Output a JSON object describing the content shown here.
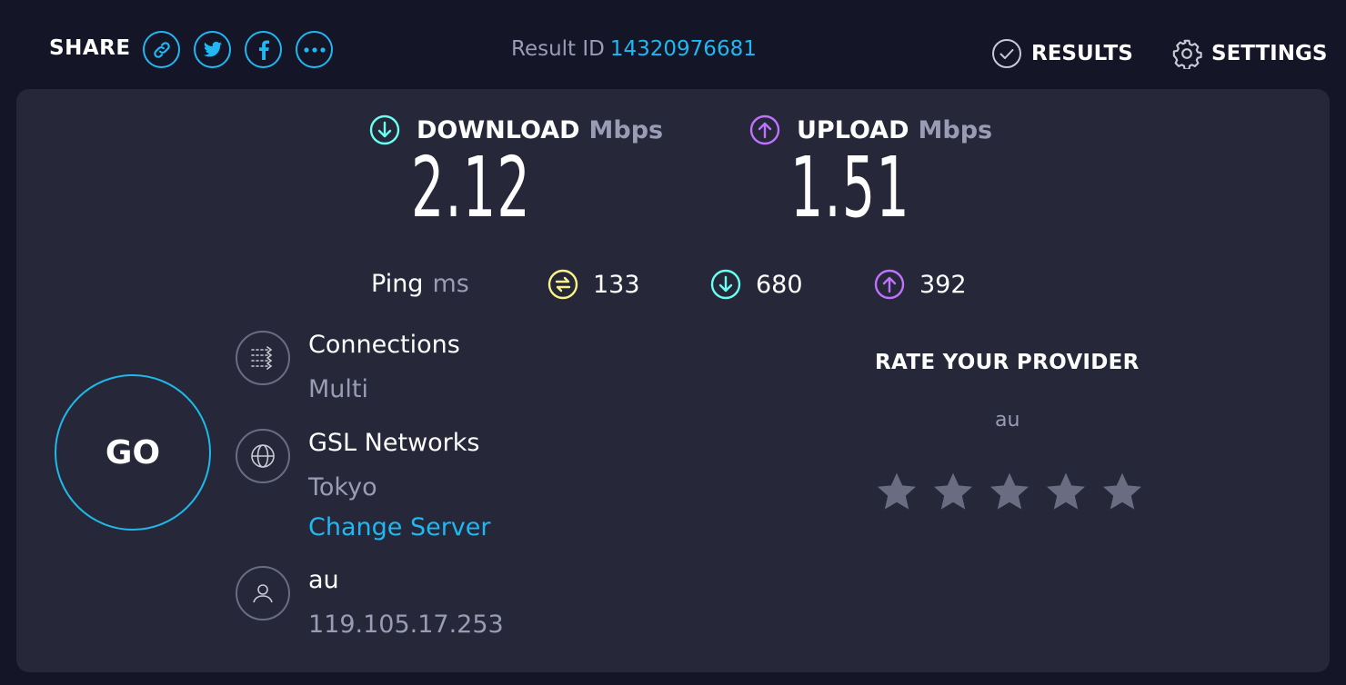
{
  "header": {
    "share_label": "SHARE",
    "share_buttons": [
      {
        "icon": "link-icon"
      },
      {
        "icon": "twitter-icon"
      },
      {
        "icon": "facebook-icon"
      },
      {
        "icon": "more-icon"
      }
    ],
    "result_id_label": "Result ID",
    "result_id_value": "14320976681",
    "results_label": "RESULTS",
    "settings_label": "SETTINGS"
  },
  "download": {
    "label": "DOWNLOAD",
    "unit": "Mbps",
    "value": "2.12",
    "icon": "download-arrow-icon",
    "color": "#6afff3"
  },
  "upload": {
    "label": "UPLOAD",
    "unit": "Mbps",
    "value": "1.51",
    "icon": "upload-arrow-icon",
    "color": "#bf71ff"
  },
  "ping": {
    "label": "Ping",
    "unit": "ms",
    "idle": "133",
    "download": "680",
    "upload": "392",
    "idle_color": "#fbf38a"
  },
  "go_label": "GO",
  "connections": {
    "title": "Connections",
    "value": "Multi"
  },
  "server": {
    "name": "GSL Networks",
    "location": "Tokyo",
    "change_label": "Change Server"
  },
  "provider": {
    "name": "au",
    "ip": "119.105.17.253"
  },
  "rate": {
    "title": "RATE YOUR PROVIDER",
    "provider": "au",
    "stars_total": 5,
    "stars_selected": 0
  }
}
